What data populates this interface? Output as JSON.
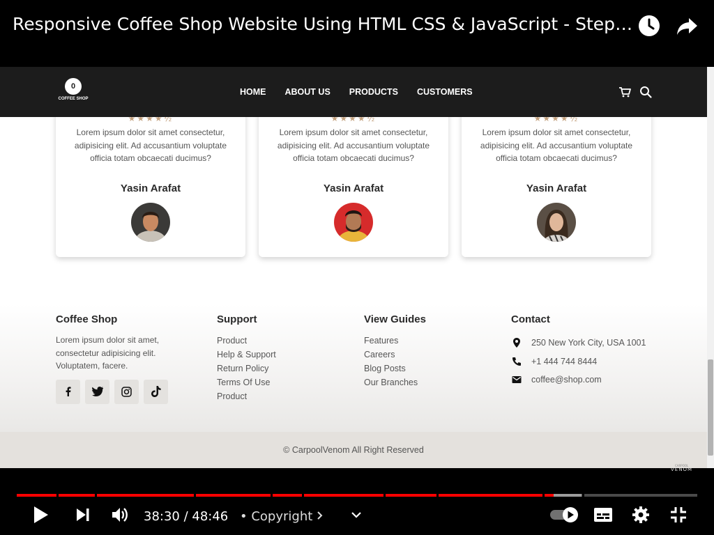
{
  "video": {
    "title": "Responsive Coffee Shop Website Using HTML CSS & JavaScript - Step By Step Tutorial",
    "watch_later_icon": "clock-icon",
    "share_icon": "share-arrow-icon"
  },
  "site": {
    "logo_text": "COFFEE SHOP",
    "logo_glyph": "0",
    "nav": [
      "HOME",
      "ABOUT US",
      "PRODUCTS",
      "CUSTOMERS"
    ],
    "nav_icons": [
      "cart-icon",
      "search-icon"
    ]
  },
  "reviews": [
    {
      "stars": "★★★★½",
      "text": "Lorem ipsum dolor sit amet consectetur, adipisicing elit. Ad accusantium voluptate officia totam obcaecati ducimus?",
      "name": "Yasin Arafat"
    },
    {
      "stars": "★★★★½",
      "text": "Lorem ipsum dolor sit amet consectetur, adipisicing elit. Ad accusantium voluptate officia totam obcaecati ducimus?",
      "name": "Yasin Arafat"
    },
    {
      "stars": "★★★★½",
      "text": "Lorem ipsum dolor sit amet consectetur, adipisicing elit. Ad accusantium voluptate officia totam obcaecati ducimus?",
      "name": "Yasin Arafat"
    }
  ],
  "footer": {
    "brand_heading": "Coffee Shop",
    "brand_desc": "Lorem ipsum dolor sit amet, consectetur adipisicing elit. Voluptatem, facere.",
    "socials": [
      "facebook-icon",
      "twitter-icon",
      "instagram-icon",
      "tiktok-icon"
    ],
    "support_heading": "Support",
    "support_links": [
      "Product",
      "Help & Support",
      "Return Policy",
      "Terms Of Use",
      "Product"
    ],
    "guides_heading": "View Guides",
    "guides_links": [
      "Features",
      "Careers",
      "Blog Posts",
      "Our Branches"
    ],
    "contact_heading": "Contact",
    "contact": [
      {
        "icon": "location-pin-icon",
        "text": "250 New York City, USA 1001"
      },
      {
        "icon": "phone-icon",
        "text": "+1 444 744 8444"
      },
      {
        "icon": "mail-icon",
        "text": "coffee@shop.com"
      }
    ],
    "copyright": "© CarpoolVenom All Right Reserved"
  },
  "player": {
    "current_time": "38:30",
    "duration": "48:46",
    "time_display": "38:30 / 48:46",
    "chapter": "• Copyright",
    "progress_fraction": 0.789,
    "buffered_fraction": 0.83,
    "watermark": "VENOM",
    "watermark_sub": "CARPOOL",
    "accent_color": "#ff0000",
    "controls": [
      "play-icon",
      "next-icon",
      "volume-icon",
      "chevron-down-icon",
      "autoplay-toggle",
      "subtitles-icon",
      "settings-gear-icon",
      "exit-fullscreen-icon"
    ]
  },
  "colors": {
    "navbar_bg": "#1c1c1c",
    "star_color": "#c4a27f",
    "copyright_bg": "#e4e1dd"
  }
}
